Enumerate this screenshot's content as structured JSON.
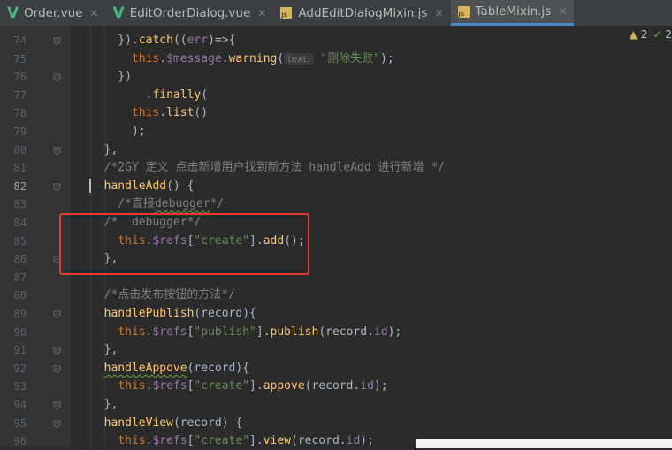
{
  "tabs": [
    {
      "label": "Order.vue",
      "icon": "vue-icon",
      "active": false
    },
    {
      "label": "EditOrderDialog.vue",
      "icon": "vue-icon",
      "active": false
    },
    {
      "label": "AddEditDialogMixin.js",
      "icon": "js-file-icon",
      "active": false
    },
    {
      "label": "TableMixin.js",
      "icon": "js-file-icon",
      "active": true
    }
  ],
  "inspections": {
    "warnings": "2",
    "ok": "2"
  },
  "colors": {
    "keyword": "#cc7832",
    "function": "#ffc66d",
    "property": "#9876aa",
    "string": "#6a8759",
    "comment": "#808080",
    "highlight_box": "#e53935"
  },
  "lines": [
    {
      "num": "74",
      "tokens": [
        {
          "t": "    }).",
          "c": "var"
        },
        {
          "t": "catch",
          "c": "fn"
        },
        {
          "t": "((",
          "c": "var"
        },
        {
          "t": "err",
          "c": "prop"
        },
        {
          "t": ")=>{",
          "c": "var"
        }
      ]
    },
    {
      "num": "75",
      "tokens": [
        {
          "t": "      ",
          "c": "var"
        },
        {
          "t": "this",
          "c": "kw"
        },
        {
          "t": ".",
          "c": "var"
        },
        {
          "t": "$message",
          "c": "prop"
        },
        {
          "t": ".",
          "c": "var"
        },
        {
          "t": "warning",
          "c": "fn"
        },
        {
          "t": "(",
          "c": "var"
        },
        {
          "t": "text:",
          "c": "hint"
        },
        {
          "t": " ",
          "c": "var"
        },
        {
          "t": "\"删除失败\"",
          "c": "str"
        },
        {
          "t": ");",
          "c": "var"
        }
      ]
    },
    {
      "num": "76",
      "tokens": [
        {
          "t": "    })",
          "c": "var"
        }
      ]
    },
    {
      "num": "77",
      "tokens": [
        {
          "t": "        .",
          "c": "var"
        },
        {
          "t": "finally",
          "c": "fn"
        },
        {
          "t": "(",
          "c": "var"
        }
      ]
    },
    {
      "num": "78",
      "tokens": [
        {
          "t": "      ",
          "c": "var"
        },
        {
          "t": "this",
          "c": "kw"
        },
        {
          "t": ".",
          "c": "var"
        },
        {
          "t": "list",
          "c": "fn"
        },
        {
          "t": "()",
          "c": "var"
        }
      ]
    },
    {
      "num": "79",
      "tokens": [
        {
          "t": "      );",
          "c": "var"
        }
      ]
    },
    {
      "num": "80",
      "tokens": [
        {
          "t": "  },",
          "c": "var"
        }
      ]
    },
    {
      "num": "81",
      "tokens": [
        {
          "t": "  /*2GY 定义 点击新增用户找到新方法 handleAdd 进行新增 */",
          "c": "cmt"
        }
      ]
    },
    {
      "num": "82",
      "tokens": [
        {
          "t": "  ",
          "c": "var"
        },
        {
          "t": "handleAdd",
          "c": "fn"
        },
        {
          "t": "() {",
          "c": "var"
        }
      ],
      "current": true
    },
    {
      "num": "83",
      "tokens": [
        {
          "t": "    /*直接",
          "c": "cmt"
        },
        {
          "t": "debugger",
          "c": "cmt",
          "squiggle": true
        },
        {
          "t": "*/",
          "c": "cmt"
        }
      ]
    },
    {
      "num": "84",
      "tokens": [
        {
          "t": "  /*  debugger*/",
          "c": "cmt"
        }
      ]
    },
    {
      "num": "85",
      "tokens": [
        {
          "t": "    ",
          "c": "var"
        },
        {
          "t": "this",
          "c": "kw"
        },
        {
          "t": ".",
          "c": "var"
        },
        {
          "t": "$refs",
          "c": "prop"
        },
        {
          "t": "[",
          "c": "var"
        },
        {
          "t": "\"create\"",
          "c": "str"
        },
        {
          "t": "].",
          "c": "var"
        },
        {
          "t": "add",
          "c": "fn"
        },
        {
          "t": "();",
          "c": "var"
        }
      ]
    },
    {
      "num": "86",
      "tokens": [
        {
          "t": "  },",
          "c": "var"
        }
      ]
    },
    {
      "num": "87",
      "tokens": []
    },
    {
      "num": "88",
      "tokens": [
        {
          "t": "  /*点击发布按钮的方法*/",
          "c": "cmt"
        }
      ]
    },
    {
      "num": "89",
      "tokens": [
        {
          "t": "  ",
          "c": "var"
        },
        {
          "t": "handlePublish",
          "c": "fn"
        },
        {
          "t": "(record){",
          "c": "var"
        }
      ]
    },
    {
      "num": "90",
      "tokens": [
        {
          "t": "    ",
          "c": "var"
        },
        {
          "t": "this",
          "c": "kw"
        },
        {
          "t": ".",
          "c": "var"
        },
        {
          "t": "$refs",
          "c": "prop"
        },
        {
          "t": "[",
          "c": "var"
        },
        {
          "t": "\"publish\"",
          "c": "str"
        },
        {
          "t": "].",
          "c": "var"
        },
        {
          "t": "publish",
          "c": "fn"
        },
        {
          "t": "(record.",
          "c": "var"
        },
        {
          "t": "id",
          "c": "prop"
        },
        {
          "t": ");",
          "c": "var"
        }
      ]
    },
    {
      "num": "91",
      "tokens": [
        {
          "t": "  },",
          "c": "var"
        }
      ]
    },
    {
      "num": "92",
      "tokens": [
        {
          "t": "  ",
          "c": "var"
        },
        {
          "t": "handleAppove",
          "c": "fn",
          "squiggle": true
        },
        {
          "t": "(record){",
          "c": "var"
        }
      ]
    },
    {
      "num": "93",
      "tokens": [
        {
          "t": "    ",
          "c": "var"
        },
        {
          "t": "this",
          "c": "kw"
        },
        {
          "t": ".",
          "c": "var"
        },
        {
          "t": "$refs",
          "c": "prop"
        },
        {
          "t": "[",
          "c": "var"
        },
        {
          "t": "\"create\"",
          "c": "str"
        },
        {
          "t": "].",
          "c": "var"
        },
        {
          "t": "appove",
          "c": "fn"
        },
        {
          "t": "(record.",
          "c": "var"
        },
        {
          "t": "id",
          "c": "prop"
        },
        {
          "t": ");",
          "c": "var"
        }
      ]
    },
    {
      "num": "94",
      "tokens": [
        {
          "t": "  },",
          "c": "var"
        }
      ]
    },
    {
      "num": "95",
      "tokens": [
        {
          "t": "  ",
          "c": "var"
        },
        {
          "t": "handleView",
          "c": "fn"
        },
        {
          "t": "(record) {",
          "c": "var"
        }
      ]
    },
    {
      "num": "96",
      "tokens": [
        {
          "t": "    ",
          "c": "var"
        },
        {
          "t": "this",
          "c": "kw"
        },
        {
          "t": ".",
          "c": "var"
        },
        {
          "t": "$refs",
          "c": "prop"
        },
        {
          "t": "[",
          "c": "var"
        },
        {
          "t": "\"create\"",
          "c": "str"
        },
        {
          "t": "].",
          "c": "var"
        },
        {
          "t": "view",
          "c": "fn"
        },
        {
          "t": "(record.",
          "c": "var"
        },
        {
          "t": "id",
          "c": "prop"
        },
        {
          "t": ");",
          "c": "var"
        }
      ]
    }
  ]
}
